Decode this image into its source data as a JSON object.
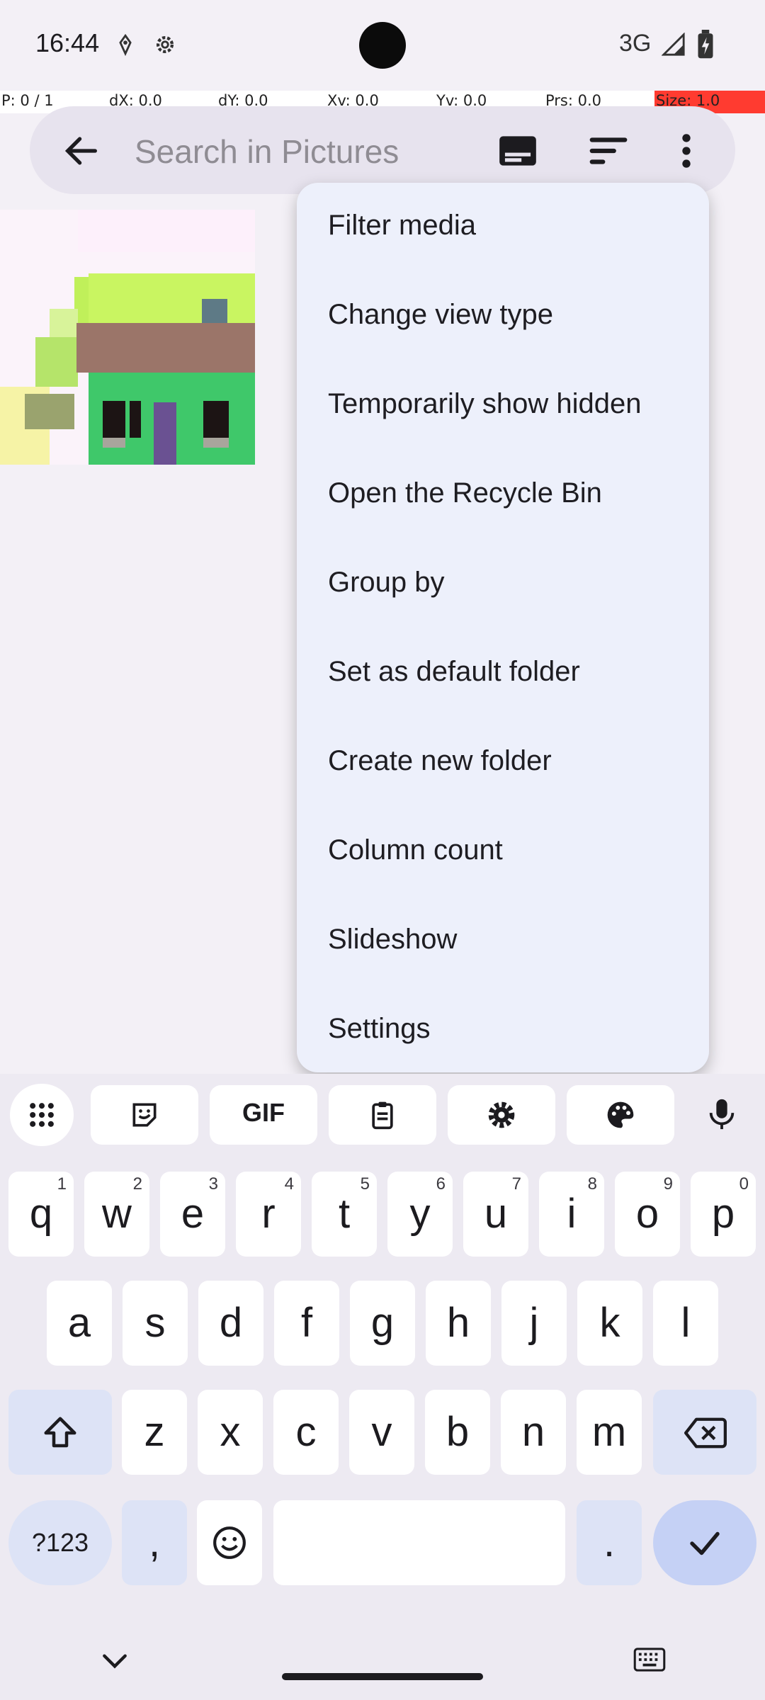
{
  "status_bar": {
    "time": "16:44",
    "network_type": "3G"
  },
  "debug_bar": {
    "pointer": "P: 0 / 1",
    "dx": "dX: 0.0",
    "dy": "dY: 0.0",
    "xv": "Xv: 0.0",
    "yv": "Yv: 0.0",
    "prs": "Prs: 0.0",
    "size": "Size: 1.0"
  },
  "search": {
    "placeholder": "Search in Pictures",
    "value": ""
  },
  "menu": {
    "items": [
      {
        "label": "Filter media"
      },
      {
        "label": "Change view type"
      },
      {
        "label": "Temporarily show hidden"
      },
      {
        "label": "Open the Recycle Bin"
      },
      {
        "label": "Group by"
      },
      {
        "label": "Set as default folder"
      },
      {
        "label": "Create new folder"
      },
      {
        "label": "Column count"
      },
      {
        "label": "Slideshow"
      },
      {
        "label": "Settings"
      }
    ]
  },
  "keyboard": {
    "toolbar": [
      "apps-grid-icon",
      "sticker-icon",
      "gif-icon",
      "clipboard-icon",
      "settings-icon",
      "palette-icon",
      "mic-icon"
    ],
    "gif_label": "GIF",
    "row1": [
      {
        "k": "q",
        "h": "1"
      },
      {
        "k": "w",
        "h": "2"
      },
      {
        "k": "e",
        "h": "3"
      },
      {
        "k": "r",
        "h": "4"
      },
      {
        "k": "t",
        "h": "5"
      },
      {
        "k": "y",
        "h": "6"
      },
      {
        "k": "u",
        "h": "7"
      },
      {
        "k": "i",
        "h": "8"
      },
      {
        "k": "o",
        "h": "9"
      },
      {
        "k": "p",
        "h": "0"
      }
    ],
    "row2": [
      "a",
      "s",
      "d",
      "f",
      "g",
      "h",
      "j",
      "k",
      "l"
    ],
    "row3": [
      "z",
      "x",
      "c",
      "v",
      "b",
      "n",
      "m"
    ],
    "symbols_label": "?123",
    "comma": ",",
    "period": "."
  },
  "colors": {
    "menu_bg": "#edf0fb",
    "key_mod_bg": "#dde3f6",
    "search_bg": "#e7e3ee",
    "size_cell": "#ff3b30"
  }
}
